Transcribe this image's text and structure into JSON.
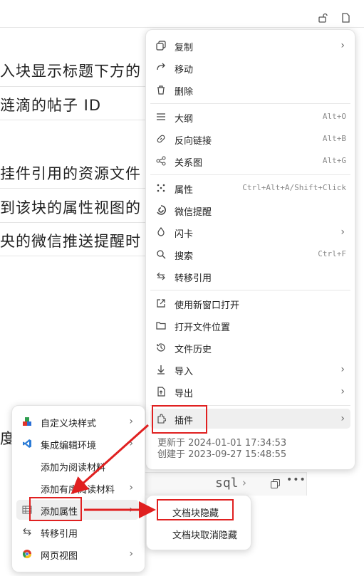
{
  "doc": {
    "lines": [
      "入块显示标题下方的",
      "涟滴的帖子 ID",
      "挂件引用的资源文件",
      "到该块的属性视图的",
      "央的微信推送提醒时",
      "度"
    ]
  },
  "code_block": {
    "lang": "sql"
  },
  "main_menu": {
    "groups": [
      [
        {
          "icon": "copy-icon",
          "label": "复制",
          "shortcut": "",
          "submenu": true
        },
        {
          "icon": "move-icon",
          "label": "移动",
          "shortcut": "",
          "submenu": false
        },
        {
          "icon": "trash-icon",
          "label": "删除",
          "shortcut": "",
          "submenu": false
        }
      ],
      [
        {
          "icon": "outline-icon",
          "label": "大纲",
          "shortcut": "Alt+O",
          "submenu": false
        },
        {
          "icon": "link-icon",
          "label": "反向链接",
          "shortcut": "Alt+B",
          "submenu": false
        },
        {
          "icon": "graph-icon",
          "label": "关系图",
          "shortcut": "Alt+G",
          "submenu": false
        }
      ],
      [
        {
          "icon": "attributes-icon",
          "label": "属性",
          "shortcut": "Ctrl+Alt+A/Shift+Click",
          "submenu": false
        },
        {
          "icon": "wechat-reminder-icon",
          "label": "微信提醒",
          "shortcut": "",
          "submenu": false
        },
        {
          "icon": "flashcard-icon",
          "label": "闪卡",
          "shortcut": "",
          "submenu": true
        },
        {
          "icon": "search-icon",
          "label": "搜索",
          "shortcut": "Ctrl+F",
          "submenu": false
        },
        {
          "icon": "transfer-ref-icon",
          "label": "转移引用",
          "shortcut": "",
          "submenu": false
        }
      ],
      [
        {
          "icon": "new-window-icon",
          "label": "使用新窗口打开",
          "shortcut": "",
          "submenu": false
        },
        {
          "icon": "folder-icon",
          "label": "打开文件位置",
          "shortcut": "",
          "submenu": false
        },
        {
          "icon": "history-icon",
          "label": "文件历史",
          "shortcut": "",
          "submenu": false
        },
        {
          "icon": "import-icon",
          "label": "导入",
          "shortcut": "",
          "submenu": true
        },
        {
          "icon": "export-icon",
          "label": "导出",
          "shortcut": "",
          "submenu": true
        }
      ],
      [
        {
          "icon": "plugin-icon",
          "label": "插件",
          "shortcut": "",
          "submenu": true
        }
      ]
    ],
    "updated": "更新于 2024-01-01 17:34:53",
    "created": "创建于 2023-09-27 15:48:55"
  },
  "plugin_menu": {
    "items": [
      {
        "icon": "block-style-icon",
        "label": "自定义块样式",
        "submenu": true
      },
      {
        "icon": "vscode-icon",
        "label": "集成编辑环境",
        "submenu": true
      },
      {
        "icon": "",
        "label": "添加为阅读材料",
        "submenu": false
      },
      {
        "icon": "",
        "label": "添加有序阅读材料",
        "submenu": true
      },
      {
        "icon": "table-icon",
        "label": "添加属性",
        "submenu": true
      },
      {
        "icon": "transfer-ref-icon",
        "label": "转移引用",
        "submenu": false
      },
      {
        "icon": "chrome-icon",
        "label": "网页视图",
        "submenu": true
      }
    ]
  },
  "attr_menu": {
    "items": [
      "文档块隐藏",
      "文档块取消隐藏"
    ]
  },
  "colors": {
    "highlight": "#e02020",
    "hover": "#efefef"
  }
}
